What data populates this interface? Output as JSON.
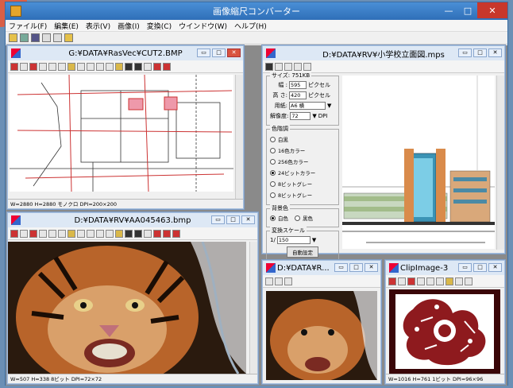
{
  "colors": {
    "accent": "#2f6fb8",
    "close": "#c8372b",
    "desktop": "#6b8fb5"
  },
  "app": {
    "title": "画像縮尺コンバーター",
    "menu": [
      "ファイル(F)",
      "編集(E)",
      "表示(V)",
      "画像(I)",
      "変換(C)",
      "ウインドウ(W)",
      "ヘルプ(H)"
    ]
  },
  "windows": {
    "cut2": {
      "title": "G:¥DATA¥RasVec¥CUT2.BMP",
      "status": "W=2880 H=2880 モノクロ DPI=200×200"
    },
    "mps": {
      "title": "D:¥DATA¥RV¥小学校立面図.mps",
      "size_group": "サイズ: 751KB",
      "width_label": "幅 :",
      "width_value": "595",
      "height_label": "高 さ:",
      "height_value": "420",
      "unit": "ピクセル",
      "paper_label": "用紙:",
      "paper_value": "A6 横",
      "dpi_label": "解像度:",
      "dpi_value": "72",
      "dpi_unit": "DPI",
      "color_group": "色階調",
      "color_options": [
        "白黒",
        "16色カラー",
        "256色カラー",
        "24ビットカラー",
        "8ビットグレー",
        "8ビットグレー"
      ],
      "bg_group": "背景色",
      "bg_white": "白色",
      "bg_black": "黒色",
      "scale_group": "変換スケール",
      "scale_prefix": "1/",
      "scale_value": "150",
      "auto_button": "自動設定"
    },
    "tiger": {
      "title": "D:¥DATA¥RV¥AA045463.bmp",
      "status": "W=507 H=338 8ビット DPI=72×72"
    },
    "small": {
      "title": "D:¥DATA¥R..."
    },
    "clip": {
      "title": "ClipImage-3",
      "status": "W=1016 H=761 1ビット DPI=96×96"
    }
  }
}
